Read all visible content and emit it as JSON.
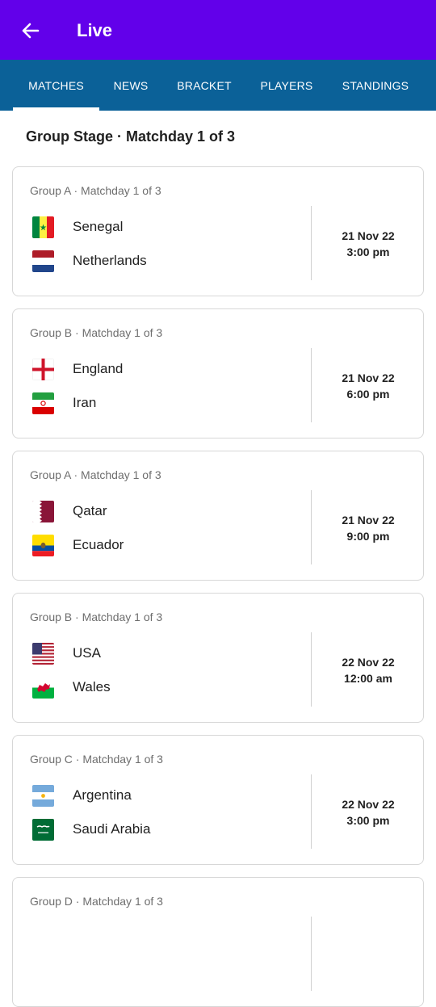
{
  "appbar": {
    "title": "Live",
    "back_icon": "arrow-left-icon"
  },
  "tabs": [
    {
      "label": "MATCHES",
      "active": true
    },
    {
      "label": "NEWS"
    },
    {
      "label": "BRACKET"
    },
    {
      "label": "PLAYERS"
    },
    {
      "label": "STANDINGS"
    }
  ],
  "colors": {
    "appbar": "#6200ea",
    "tabbar": "#0b6198"
  },
  "section_title": "Group Stage · Matchday 1 of 3",
  "matches": [
    {
      "subtitle": "Group A · Matchday 1 of 3",
      "home": "Senegal",
      "away": "Netherlands",
      "date": "21 Nov 22",
      "time": "3:00 pm"
    },
    {
      "subtitle": "Group B · Matchday 1 of 3",
      "home": "England",
      "away": "Iran",
      "date": "21 Nov 22",
      "time": "6:00 pm"
    },
    {
      "subtitle": "Group A · Matchday 1 of 3",
      "home": "Qatar",
      "away": "Ecuador",
      "date": "21 Nov 22",
      "time": "9:00 pm"
    },
    {
      "subtitle": "Group B · Matchday 1 of 3",
      "home": "USA",
      "away": "Wales",
      "date": "22 Nov 22",
      "time": "12:00 am"
    },
    {
      "subtitle": "Group C · Matchday 1 of 3",
      "home": "Argentina",
      "away": "Saudi Arabia",
      "date": "22 Nov 22",
      "time": "3:00 pm"
    },
    {
      "subtitle": "Group D · Matchday 1 of 3"
    }
  ]
}
